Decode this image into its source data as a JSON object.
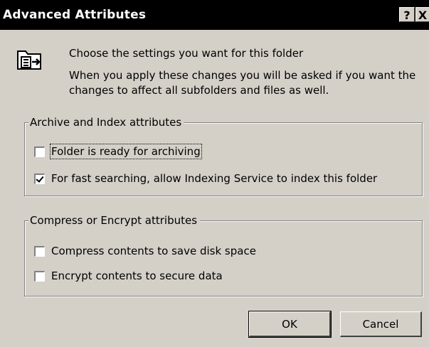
{
  "window": {
    "title": "Advanced Attributes",
    "help_label": "?",
    "close_label": "X"
  },
  "header": {
    "heading": "Choose the settings you want for this folder",
    "note": "When you apply these changes you will be asked if you want the changes to affect all subfolders and files as well.",
    "icon": "folder-properties-icon"
  },
  "archive_group": {
    "legend": "Archive and Index attributes",
    "options": [
      {
        "label": "Folder is ready for archiving",
        "checked": false
      },
      {
        "label": "For fast searching, allow Indexing Service to index this folder",
        "checked": true
      }
    ]
  },
  "compress_group": {
    "legend": "Compress or Encrypt attributes",
    "options": [
      {
        "label": "Compress contents to save disk space",
        "checked": false
      },
      {
        "label": "Encrypt contents to secure data",
        "checked": false
      }
    ]
  },
  "buttons": {
    "ok_label": "OK",
    "cancel_label": "Cancel"
  }
}
